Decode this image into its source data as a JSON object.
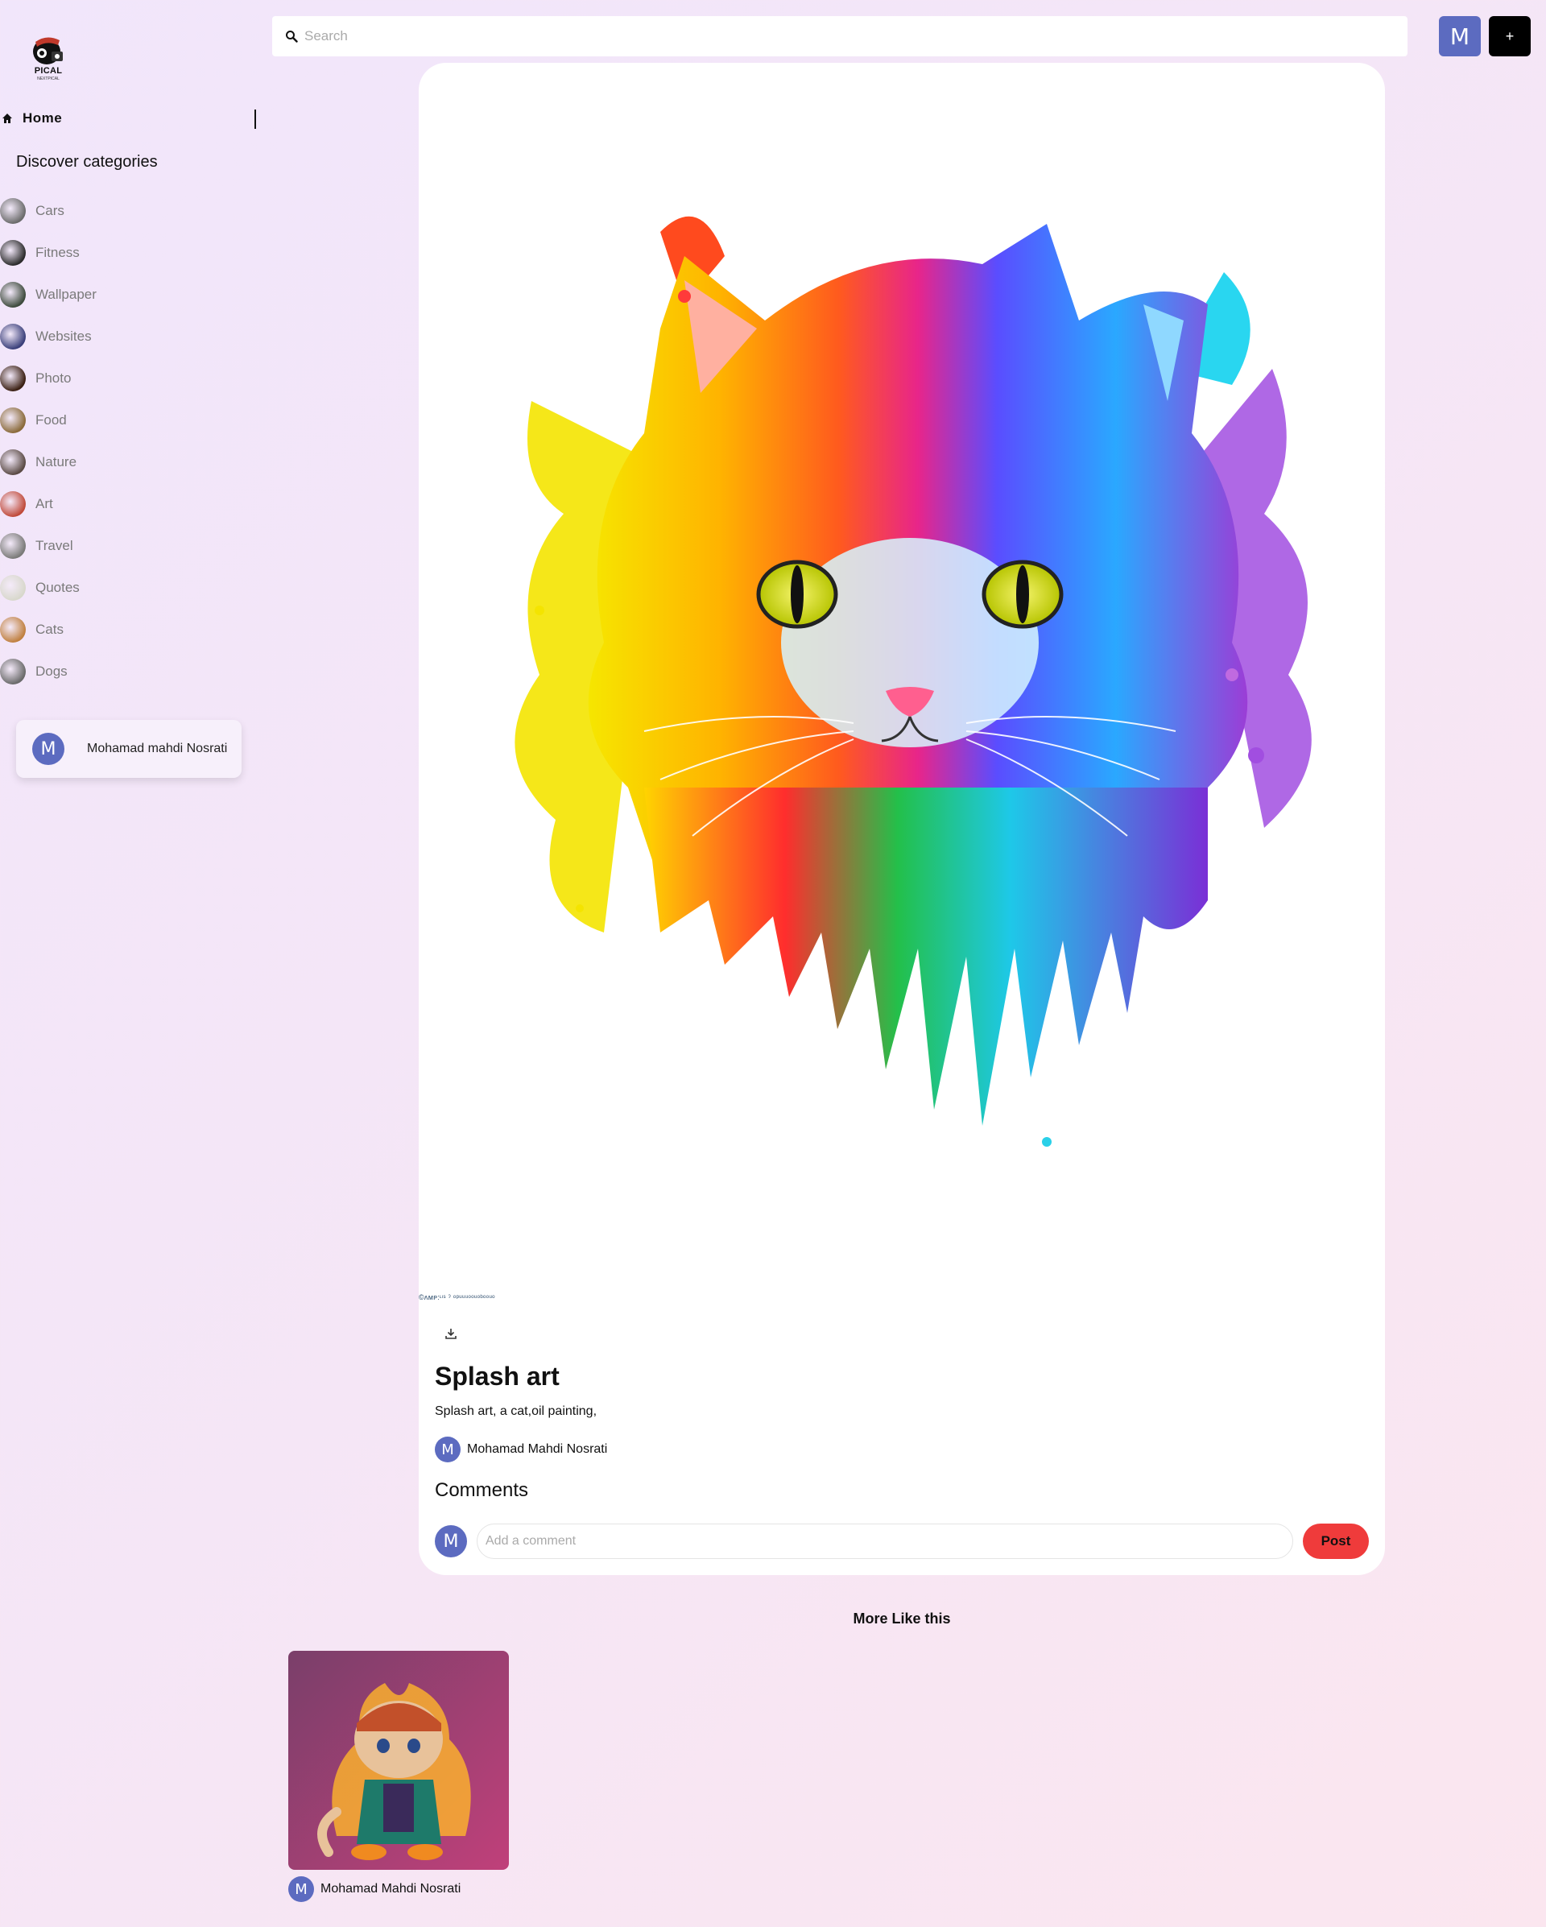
{
  "logo": {
    "text": "PICAL",
    "subtext": "NEXTPICAL"
  },
  "sidebar": {
    "home_label": "Home",
    "discover_heading": "Discover categories",
    "categories": [
      {
        "label": "Cars",
        "color": "#6b6b6b"
      },
      {
        "label": "Fitness",
        "color": "#2b2b2b"
      },
      {
        "label": "Wallpaper",
        "color": "#3d4a3c"
      },
      {
        "label": "Websites",
        "color": "#3a3f7a"
      },
      {
        "label": "Photo",
        "color": "#3a1f12"
      },
      {
        "label": "Food",
        "color": "#8a6a3a"
      },
      {
        "label": "Nature",
        "color": "#5a4a44"
      },
      {
        "label": "Art",
        "color": "#c04a3a"
      },
      {
        "label": "Travel",
        "color": "#7a7a78"
      },
      {
        "label": "Quotes",
        "color": "#d8d8cc"
      },
      {
        "label": "Cats",
        "color": "#c08040"
      },
      {
        "label": "Dogs",
        "color": "#6a6a6a"
      }
    ],
    "user_card": {
      "avatar_letter": "M",
      "name": "Mohamad mahdi Nosrati"
    }
  },
  "topbar": {
    "search_placeholder": "Search",
    "avatar_letter": "M",
    "add_label": "+"
  },
  "pin": {
    "watermark": "©ʌᴍᴘ:ᶫᶦˢ ˀ ᵒᵖᵘᵘᵘᵒᵒᵘᵒᵇᵒᵒᵘᵒ",
    "title": "Splash art",
    "description": "Splash art, a cat,oil painting,",
    "author": {
      "avatar_letter": "M",
      "name": "Mohamad Mahdi Nosrati"
    },
    "comments_heading": "Comments",
    "comment_avatar_letter": "M",
    "comment_placeholder": "Add a comment",
    "post_label": "Post"
  },
  "more": {
    "heading": "More Like this",
    "items": [
      {
        "author_letter": "M",
        "author_name": "Mohamad Mahdi Nosrati"
      }
    ]
  },
  "colors": {
    "accent": "#5c6bc0",
    "post": "#ef3b3b"
  }
}
